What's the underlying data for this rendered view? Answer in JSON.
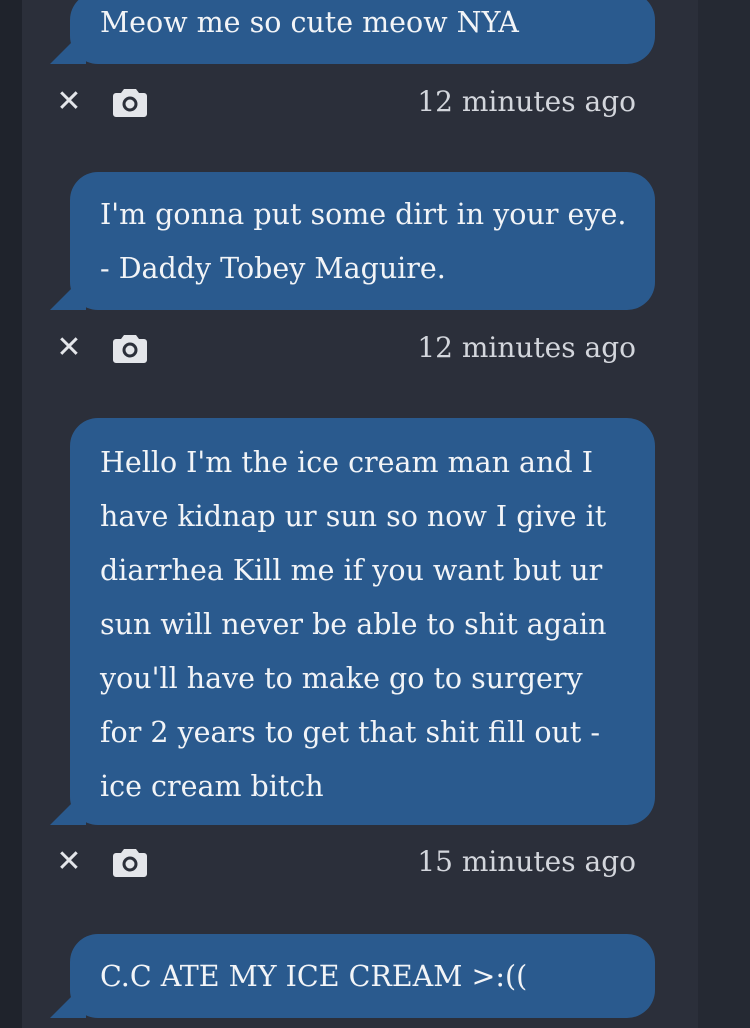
{
  "messages": [
    {
      "text": "Meow me so cute meow NYA",
      "time": "12 minutes ago"
    },
    {
      "text": "I'm gonna put some dirt in your eye. - Daddy Tobey Maguire.",
      "time": "12 minutes ago"
    },
    {
      "text": "Hello I'm the ice cream man and I have kidnap ur sun so now I give it diarrhea Kill me if you want but ur sun will never be able to shit again you'll have to make go to surgery for 2 years to get that shit fill out - ice cream bitch",
      "time": "15 minutes ago"
    },
    {
      "text": "C.C ATE MY ICE CREAM >:(("
    }
  ],
  "actions": {
    "delete_glyph": "✕",
    "camera_icon": "camera-icon"
  },
  "colors": {
    "page_background": "#1f232c",
    "feed_background": "#2b2f3a",
    "bubble": "#2a5a8e",
    "bubble_text": "#f2f4f7",
    "meta_text": "#d3d6dc"
  }
}
